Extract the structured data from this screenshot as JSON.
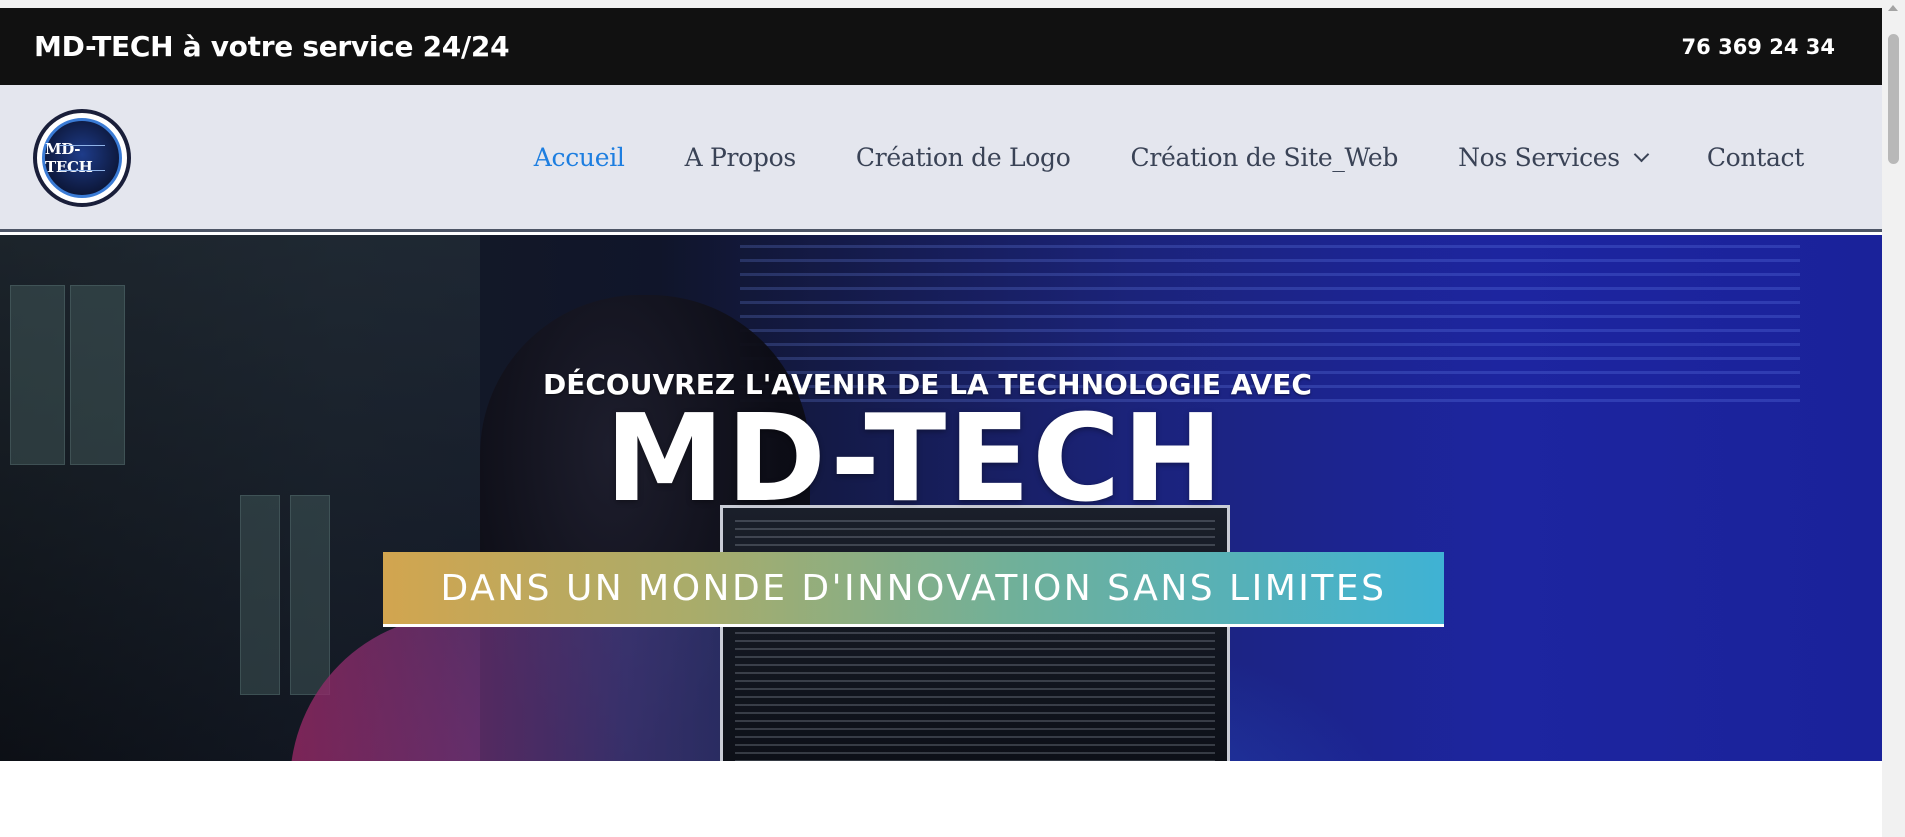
{
  "topbar": {
    "tagline": "MD-TECH à votre service 24/24",
    "phone": "76 369 24 34"
  },
  "logo": {
    "text": "MD-TECH"
  },
  "nav": {
    "items": [
      {
        "label": "Accueil",
        "active": true
      },
      {
        "label": "A Propos",
        "active": false
      },
      {
        "label": "Création de Logo",
        "active": false
      },
      {
        "label": "Création de Site_Web",
        "active": false
      },
      {
        "label": "Nos Services",
        "active": false,
        "icon": "chevron-down-icon"
      },
      {
        "label": "Contact",
        "active": false
      }
    ]
  },
  "hero": {
    "eyebrow": "DÉCOUVREZ L'AVENIR DE LA TECHNOLOGIE AVEC",
    "title": "MD-TECH",
    "banner": "DANS UN MONDE D'INNOVATION SANS LIMITES"
  },
  "colors": {
    "topbar_bg": "#111111",
    "nav_bg": "#e4e6ee",
    "nav_active": "#1d7ee0",
    "nav_text": "#3a4356",
    "banner_start": "#d2a54f",
    "banner_end": "#3fb2d4"
  }
}
